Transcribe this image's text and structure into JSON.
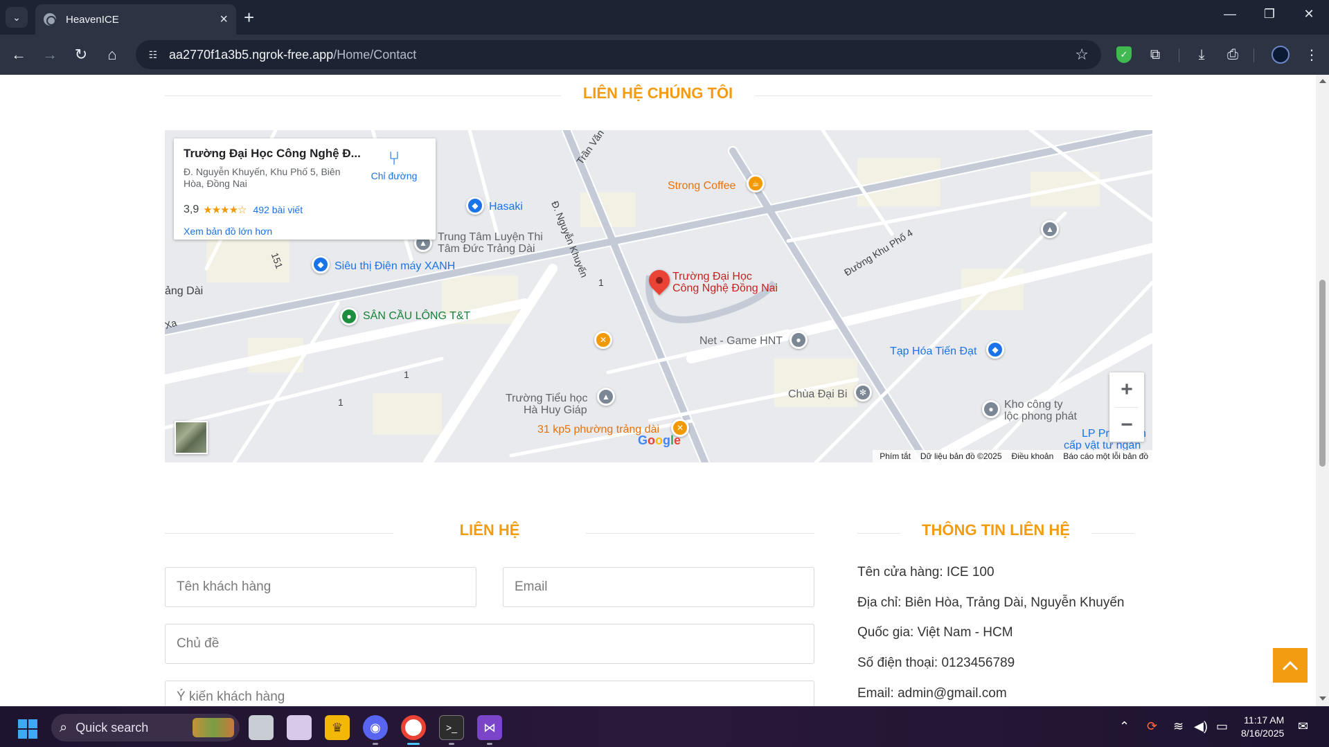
{
  "browser": {
    "tab_title": "HeavenICE",
    "url_host": "aa2770f1a3b5.ngrok-free.app",
    "url_path": "/Home/Contact"
  },
  "page": {
    "map_heading": "LIÊN HỆ CHÚNG TÔI",
    "map": {
      "place_name": "Trường Đại Học Công Nghệ Đ...",
      "place_address": "Đ. Nguyễn Khuyến, Khu Phố 5, Biên Hòa, Đồng Nai",
      "rating": "3,9",
      "rating_stars": "★★★★☆",
      "reviews": "492 bài viết",
      "directions": "Chỉ đường",
      "view_larger": "Xem bản đồ lớn hơn",
      "labels": {
        "strong_coffee": "Strong Coffee",
        "hasaki": "Hasaki",
        "trung_tam_1": "Trung Tâm Luyện Thi",
        "trung_tam_2": "Tâm Đức Trảng Dài",
        "sieu_thi": "Siêu thị Điện máy XANH",
        "san_cau_long": "SÂN CẦU LÔNG T&T",
        "school_1": "Trường Đại Học",
        "school_2": "Công Nghệ Đồng Nai",
        "net_game": "Net - Game HNT",
        "tap_hoa": "Tạp Hóa Tiến Đạt",
        "chua": "Chùa Đại Bi",
        "kho_1": "Kho công ty",
        "kho_2": "lộc phong phát",
        "lp_1": "LP Pr",
        "lp_1b": "h",
        "lp_2": "cấp vật tư ngàn",
        "kp5": "31 kp5 phường trảng dài",
        "truong_tieu_hoc_1": "Trường Tiểu học",
        "truong_tieu_hoc_2": "Hà Huy Giáp",
        "road_tran_van": "Trần Văn",
        "road_nguyen_khuyen": "Đ. Nguyễn Khuyến",
        "road_khu_pho_4": "Đường Khu Phố 4",
        "road_151": "151",
        "road_1a": "1",
        "road_1b": "1",
        "road_1c": "1",
        "trang_dai": "ảng Dài",
        "xa": "Xa"
      },
      "google": "Google",
      "attribution": {
        "shortcuts": "Phím tắt",
        "map_data": "Dữ liệu bản đồ ©2025",
        "terms": "Điều khoản",
        "report": "Báo cáo một lỗi bản đồ"
      }
    },
    "contact_heading": "LIÊN HỆ",
    "info_heading": "THÔNG TIN LIÊN HỆ",
    "form": {
      "name_placeholder": "Tên khách hàng",
      "email_placeholder": "Email",
      "subject_placeholder": "Chủ đề",
      "message_placeholder": "Ý kiến khách hàng"
    },
    "info": {
      "store": "Tên cửa hàng: ICE 100",
      "address": "Địa chỉ: Biên Hòa, Trảng Dài, Nguyễn Khuyến",
      "country": "Quốc gia: Việt Nam - HCM",
      "phone": "Số điện thoại: 0123456789",
      "email": "Email: admin@gmail.com"
    }
  },
  "taskbar": {
    "search_label": "Quick search",
    "time": "11:17 AM",
    "date": "8/16/2025"
  },
  "colors": {
    "accent": "#f39c12",
    "link": "#1a73e8"
  }
}
